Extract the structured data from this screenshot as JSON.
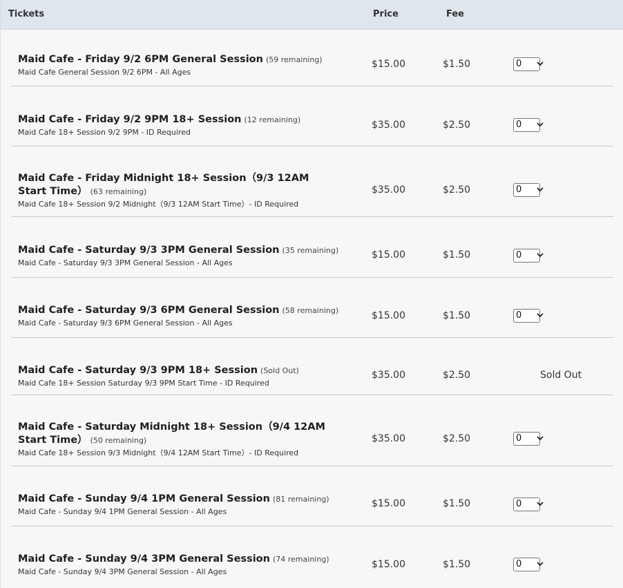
{
  "header": {
    "tickets_label": "Tickets",
    "price_label": "Price",
    "fee_label": "Fee"
  },
  "tickets": [
    {
      "name": "Maid Cafe - Friday 9/2 6PM General Session",
      "remaining": "(59 remaining)",
      "desc": "Maid Cafe General Session 9/2 6PM - All Ages",
      "price": "$15.00",
      "fee": "$1.50",
      "qty": "0"
    },
    {
      "name": "Maid Cafe - Friday 9/2 9PM 18+ Session",
      "remaining": "(12 remaining)",
      "desc": "Maid Cafe 18+ Session 9/2 9PM - ID Required",
      "price": "$35.00",
      "fee": "$2.50",
      "qty": "0"
    },
    {
      "name": "Maid Cafe - Friday Midnight 18+ Session（9/3 12AM Start Time）",
      "remaining": "(63 remaining)",
      "desc": "Maid Cafe 18+ Session 9/2 Midnight（9/3 12AM Start Time）- ID Required",
      "price": "$35.00",
      "fee": "$2.50",
      "qty": "0"
    },
    {
      "name": "Maid Cafe - Saturday 9/3 3PM General Session",
      "remaining": "(35 remaining)",
      "desc": "Maid Cafe - Saturday 9/3 3PM General Session - All Ages",
      "price": "$15.00",
      "fee": "$1.50",
      "qty": "0"
    },
    {
      "name": "Maid Cafe - Saturday 9/3 6PM General Session",
      "remaining": "(58 remaining)",
      "desc": "Maid Cafe - Saturday 9/3 6PM General Session - All Ages",
      "price": "$15.00",
      "fee": "$1.50",
      "qty": "0"
    },
    {
      "name": "Maid Cafe - Saturday 9/3 9PM 18+ Session",
      "remaining": "(Sold Out)",
      "desc": "Maid Cafe 18+ Session Saturday 9/3 9PM Start Time - ID Required",
      "price": "$35.00",
      "fee": "$2.50",
      "status": "Sold Out"
    },
    {
      "name": "Maid Cafe - Saturday Midnight 18+ Session（9/4 12AM Start Time）",
      "remaining": "(50 remaining)",
      "desc": "Maid Cafe 18+ Session 9/3 Midnight（9/4 12AM Start Time）- ID Required",
      "price": "$35.00",
      "fee": "$2.50",
      "qty": "0"
    },
    {
      "name": "Maid Cafe - Sunday 9/4 1PM General Session",
      "remaining": "(81 remaining)",
      "desc": "Maid Cafe - Sunday 9/4 1PM General Session - All Ages",
      "price": "$15.00",
      "fee": "$1.50",
      "qty": "0"
    },
    {
      "name": "Maid Cafe - Sunday 9/4 3PM General Session",
      "remaining": "(74 remaining)",
      "desc": "Maid Cafe - Sunday 9/4 3PM General Session - All Ages",
      "price": "$15.00",
      "fee": "$1.50",
      "qty": "0"
    }
  ]
}
